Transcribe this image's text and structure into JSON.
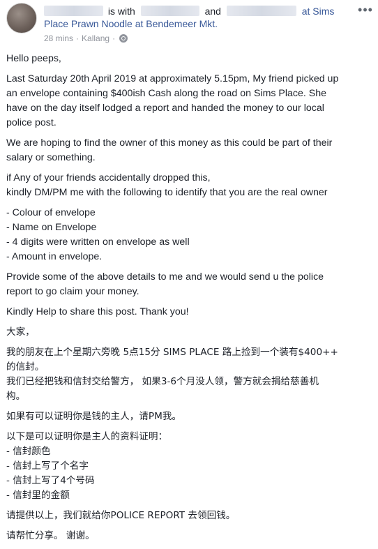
{
  "post": {
    "header": {
      "with_text": "is with",
      "and_text": "and",
      "at_text": "at Sims",
      "place_line2": "Place Prawn Noodle at Bendemeer Mkt.",
      "time": "28 mins",
      "location": "Kallang",
      "more_icon": "ellipsis-icon",
      "privacy_icon": "globe-icon"
    },
    "body": {
      "greeting": "Hello peeps,",
      "p1_l1": "Last Saturday 20th April 2019 at approximately 5.15pm, My friend picked up",
      "p1_l2": "an envelope containing $400ish Cash along the road on Sims Place. She",
      "p1_l3": "have on the day itself lodged a report and handed the money to our local",
      "p1_l4": "police post.",
      "p2_l1": "We are hoping to find the owner of this money as this could be part of their",
      "p2_l2": "salary or something.",
      "p3_l1": "if Any of your friends accidentally dropped this,",
      "p3_l2": "kindly DM/PM me with the following to identify that you are the real owner",
      "list": [
        "- Colour of envelope",
        "- Name on Envelope",
        "- 4 digits were written on envelope as well",
        "- Amount in envelope."
      ],
      "p4_l1": "Provide some of the above details to me and we would send u the police",
      "p4_l2": "report to go claim your money.",
      "p5": "Kindly Help to share this post. Thank you!",
      "cn_greeting": "大家，",
      "cn_p1_l1": "我的朋友在上个星期六旁晚 5点15分 SIMS PLACE 路上捡到一个装有$400++",
      "cn_p1_l2": "的信封。",
      "cn_p1_l3": "我们已经把钱和信封交给警方， 如果3-6个月没人领，警方就会捐给慈善机",
      "cn_p1_l4": "构。",
      "cn_p2": "如果有可以证明你是钱的主人，请PM我。",
      "cn_p3_title": "以下是可以证明你是主人的资料证明：",
      "cn_list": [
        "- 信封颜色",
        "- 信封上写了个名字",
        "- 信封上写了4个号码",
        "- 信封里的金额"
      ],
      "cn_p4": "请提供以上，我们就给你POLICE REPORT 去领回钱。",
      "cn_p5": "请帮忙分享。 谢谢。"
    }
  }
}
